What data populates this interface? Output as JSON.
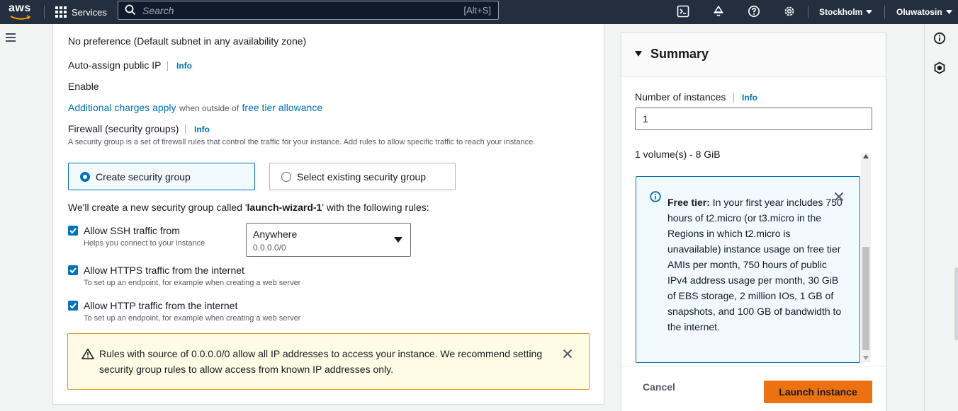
{
  "topnav": {
    "logo": "aws",
    "services_label": "Services",
    "search_placeholder": "Search",
    "search_shortcut": "[Alt+S]",
    "icons": [
      "cloudshell-icon",
      "bell-icon",
      "help-icon",
      "gear-icon"
    ],
    "region": "Stockholm",
    "user": "Oluwatosin"
  },
  "network": {
    "subnet_value": "No preference (Default subnet in any availability zone)",
    "auto_assign_label": "Auto-assign public IP",
    "info": "Info",
    "auto_assign_value": "Enable",
    "charges_link": "Additional charges apply",
    "charges_middle": "when outside of",
    "free_tier_link": "free tier allowance"
  },
  "firewall": {
    "label": "Firewall (security groups)",
    "info": "Info",
    "description": "A security group is a set of firewall rules that control the traffic for your instance. Add rules to allow specific traffic to reach your instance.",
    "option_create": "Create security group",
    "option_existing": "Select existing security group",
    "create_note_prefix": "We'll create a new security group called '",
    "group_name": "launch-wizard-1",
    "create_note_suffix": "' with the following rules:",
    "rules": [
      {
        "label": "Allow SSH traffic from",
        "help": "Helps you connect to your instance",
        "checked": true
      },
      {
        "label": "Allow HTTPS traffic from the internet",
        "help": "To set up an endpoint, for example when creating a web server",
        "checked": true
      },
      {
        "label": "Allow HTTP traffic from the internet",
        "help": "To set up an endpoint, for example when creating a web server",
        "checked": true
      }
    ],
    "ssh_source": {
      "value": "Anywhere",
      "sub": "0.0.0.0/0"
    },
    "warning": "Rules with source of 0.0.0.0/0 allow all IP addresses to access your instance. We recommend setting security group rules to allow access from known IP addresses only."
  },
  "summary": {
    "title": "Summary",
    "instances_label": "Number of instances",
    "info": "Info",
    "instances_value": "1",
    "volumes": "1 volume(s) - 8 GiB",
    "free_tier_title": "Free tier:",
    "free_tier_text": " In your first year includes 750 hours of t2.micro (or t3.micro in the Regions in which t2.micro is unavailable) instance usage on free tier AMIs per month, 750 hours of public IPv4 address usage per month, 30 GiB of EBS storage, 2 million IOs, 1 GB of snapshots, and 100 GB of bandwidth to the internet.",
    "cancel": "Cancel",
    "launch": "Launch instance"
  },
  "colors": {
    "nav_bg": "#232f3e",
    "link": "#0073bb",
    "primary_button": "#ec7211",
    "warning_bg": "#fffbe5",
    "info_bg": "#f1faff"
  }
}
